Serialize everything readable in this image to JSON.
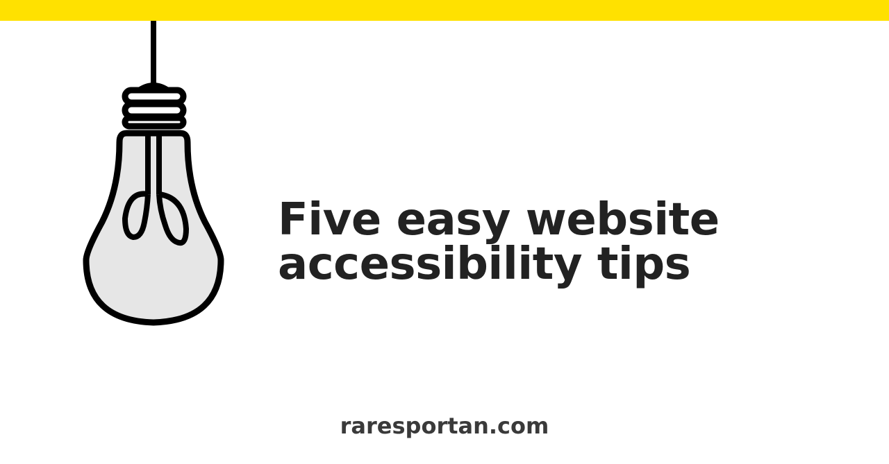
{
  "brand": {
    "bar_color": "#ffe100",
    "text_color": "#222222"
  },
  "illustration": {
    "icon": "lightbulb-icon",
    "fill_color": "#e6e6e6",
    "stroke_color": "#000000"
  },
  "headline": {
    "line1": "Five easy website",
    "line2": "accessibility tips"
  },
  "footer": {
    "site": "raresportan.com"
  }
}
